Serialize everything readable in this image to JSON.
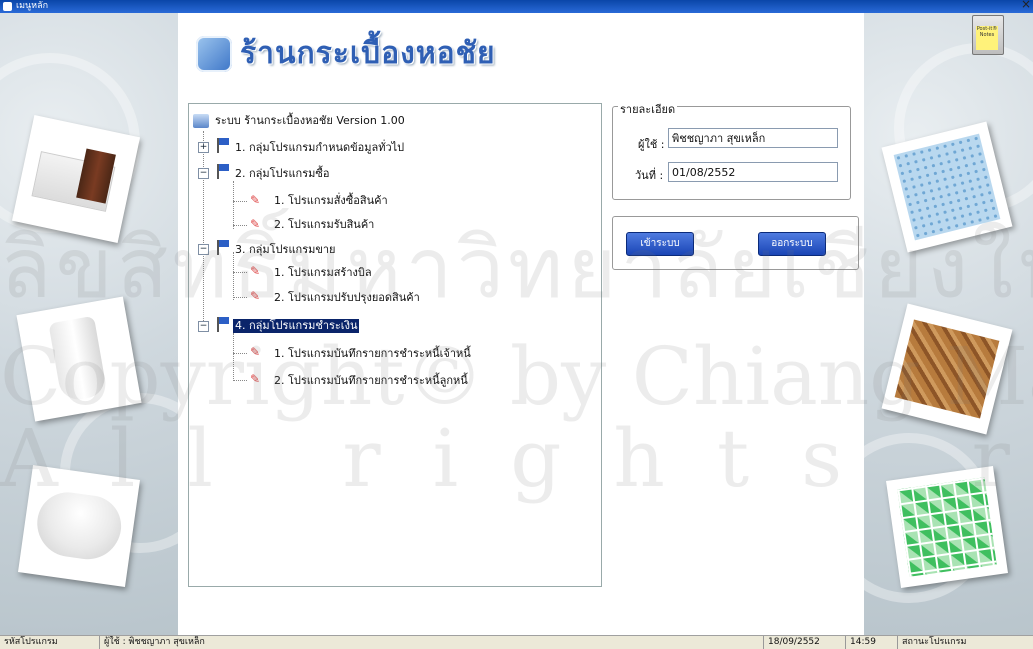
{
  "window": {
    "title": "เมนูหลัก",
    "close": "×"
  },
  "header": {
    "logo_text": "ร้านกระเบื้องหอชัย"
  },
  "watermark": {
    "line1": "ลิขสิทธิ์มหาวิทยาลัยเชียงใหม่",
    "line2": "Copyright© by Chiang Mai University",
    "line3": "All rights reserved"
  },
  "tree": {
    "root": "ระบบ ร้านกระเบื้องหอชัย Version 1.00",
    "groups": [
      {
        "label": "1. กลุ่มโปรแกรมกำหนดข้อมูลทั่วไป",
        "toggle": "+",
        "items": []
      },
      {
        "label": "2. กลุ่มโปรแกรมซื้อ",
        "toggle": "−",
        "items": [
          "1. โปรแกรมสั่งซื้อสินค้า",
          "2. โปรแกรมรับสินค้า"
        ]
      },
      {
        "label": "3. กลุ่มโปรแกรมขาย",
        "toggle": "−",
        "items": [
          "1. โปรแกรมสร้างบิล",
          "2. โปรแกรมปรับปรุงยอดสินค้า"
        ]
      },
      {
        "label": "4. กลุ่มโปรแกรมชำระเงิน",
        "toggle": "−",
        "items": [
          "1. โปรแกรมบันทึกรายการชำระหนี้เจ้าหนี้",
          "2. โปรแกรมบันทึกรายการชำระหนี้ลูกหนี้"
        ]
      }
    ]
  },
  "detail": {
    "legend": "รายละเอียด",
    "user_label": "ผู้ใช้ :",
    "user_value": "พิชชญาภา สุขเหล็ก",
    "date_label": "วันที่ :",
    "date_value": "01/08/2552"
  },
  "buttons": {
    "login": "เข้าระบบ",
    "logout": "ออกระบบ"
  },
  "postit": {
    "label": "Post-it® Notes"
  },
  "statusbar": {
    "program_code": "รหัสโปรแกรม",
    "user": "ผู้ใช้ : พิชชญาภา สุขเหล็ก",
    "date": "18/09/2552",
    "time": "14:59",
    "program_status": "สถานะโปรแกรม"
  },
  "colors": {
    "titlebar": "#0a46a8",
    "selection": "#0a246a",
    "button": "#2552c8",
    "logo": "#2f5fb4"
  }
}
